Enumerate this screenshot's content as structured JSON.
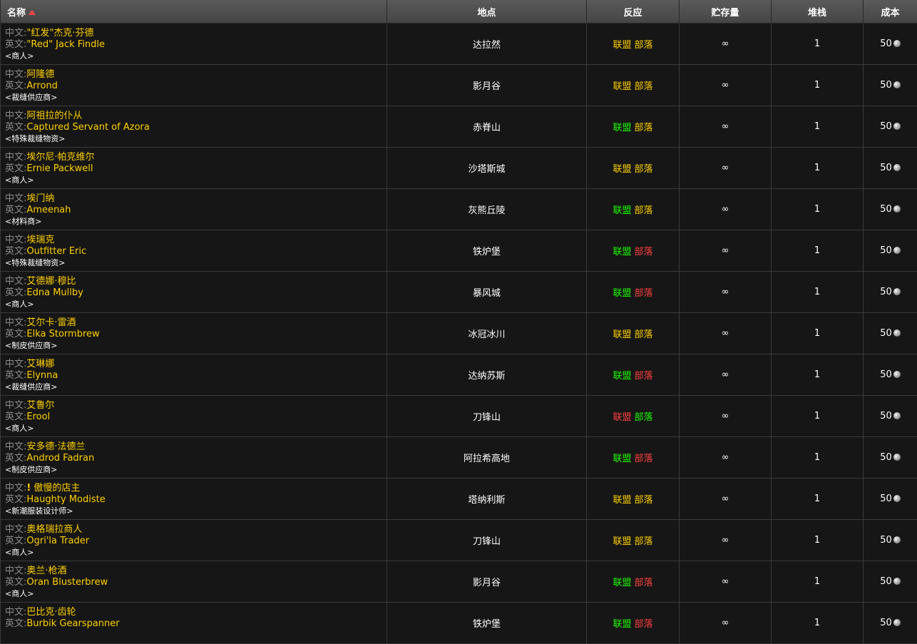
{
  "headers": {
    "name": "名称",
    "location": "地点",
    "react": "反应",
    "stock": "贮存量",
    "stack": "堆栈",
    "cost": "成本"
  },
  "labels": {
    "zh_prefix": "中文:",
    "en_prefix": "英文:",
    "alliance": "联盟",
    "horde": "部落"
  },
  "colors": {
    "friendly": "#1eff00",
    "neutral": "#ffd100",
    "hostile": "#ff4040"
  },
  "rows": [
    {
      "zh": "\"红发\"杰克·芬德",
      "en": "\"Red\" Jack Findle",
      "title": "<商人>",
      "location": "达拉然",
      "alliance": "neutral",
      "horde": "neutral",
      "stock": "∞",
      "stack": "1",
      "cost": "50",
      "quest": false
    },
    {
      "zh": "阿隆德",
      "en": "Arrond",
      "title": "<裁缝供应商>",
      "location": "影月谷",
      "alliance": "neutral",
      "horde": "neutral",
      "stock": "∞",
      "stack": "1",
      "cost": "50",
      "quest": false
    },
    {
      "zh": "阿祖拉的仆从",
      "en": "Captured Servant of Azora",
      "title": "<特殊裁缝物资>",
      "location": "赤脊山",
      "alliance": "friendly",
      "horde": "neutral",
      "stock": "∞",
      "stack": "1",
      "cost": "50",
      "quest": false
    },
    {
      "zh": "埃尔尼·帕克维尔",
      "en": "Ernie Packwell",
      "title": "<商人>",
      "location": "沙塔斯城",
      "alliance": "neutral",
      "horde": "neutral",
      "stock": "∞",
      "stack": "1",
      "cost": "50",
      "quest": false
    },
    {
      "zh": "埃门纳",
      "en": "Ameenah",
      "title": "<材料商>",
      "location": "灰熊丘陵",
      "alliance": "friendly",
      "horde": "neutral",
      "stock": "∞",
      "stack": "1",
      "cost": "50",
      "quest": false
    },
    {
      "zh": "埃瑞克",
      "en": "Outfitter Eric",
      "title": "<特殊裁缝物资>",
      "location": "铁炉堡",
      "alliance": "friendly",
      "horde": "hostile",
      "stock": "∞",
      "stack": "1",
      "cost": "50",
      "quest": false
    },
    {
      "zh": "艾德娜·穆比",
      "en": "Edna Mullby",
      "title": "<商人>",
      "location": "暴风城",
      "alliance": "friendly",
      "horde": "hostile",
      "stock": "∞",
      "stack": "1",
      "cost": "50",
      "quest": false
    },
    {
      "zh": "艾尔卡·雷酒",
      "en": "Elka Stormbrew",
      "title": "<制皮供应商>",
      "location": "冰冠冰川",
      "alliance": "neutral",
      "horde": "neutral",
      "stock": "∞",
      "stack": "1",
      "cost": "50",
      "quest": false
    },
    {
      "zh": "艾琳娜",
      "en": "Elynna",
      "title": "<裁缝供应商>",
      "location": "达纳苏斯",
      "alliance": "friendly",
      "horde": "hostile",
      "stock": "∞",
      "stack": "1",
      "cost": "50",
      "quest": false
    },
    {
      "zh": "艾鲁尔",
      "en": "Erool",
      "title": "<商人>",
      "location": "刀锋山",
      "alliance": "hostile",
      "horde": "friendly",
      "stock": "∞",
      "stack": "1",
      "cost": "50",
      "quest": false
    },
    {
      "zh": "安多德·法德兰",
      "en": "Androd Fadran",
      "title": "<制皮供应商>",
      "location": "阿拉希高地",
      "alliance": "friendly",
      "horde": "hostile",
      "stock": "∞",
      "stack": "1",
      "cost": "50",
      "quest": false
    },
    {
      "zh": "傲慢的店主",
      "en": "Haughty Modiste",
      "title": "<新潮服装设计师>",
      "location": "塔纳利斯",
      "alliance": "neutral",
      "horde": "neutral",
      "stock": "∞",
      "stack": "1",
      "cost": "50",
      "quest": true
    },
    {
      "zh": "奥格瑞拉商人",
      "en": "Ogri'la Trader",
      "title": "<商人>",
      "location": "刀锋山",
      "alliance": "neutral",
      "horde": "neutral",
      "stock": "∞",
      "stack": "1",
      "cost": "50",
      "quest": false
    },
    {
      "zh": "奥兰·枪酒",
      "en": "Oran Blusterbrew",
      "title": "<商人>",
      "location": "影月谷",
      "alliance": "friendly",
      "horde": "hostile",
      "stock": "∞",
      "stack": "1",
      "cost": "50",
      "quest": false
    },
    {
      "zh": "巴比克·齿轮",
      "en": "Burbik Gearspanner",
      "title": "",
      "location": "铁炉堡",
      "alliance": "friendly",
      "horde": "hostile",
      "stock": "∞",
      "stack": "1",
      "cost": "50",
      "quest": false
    }
  ]
}
